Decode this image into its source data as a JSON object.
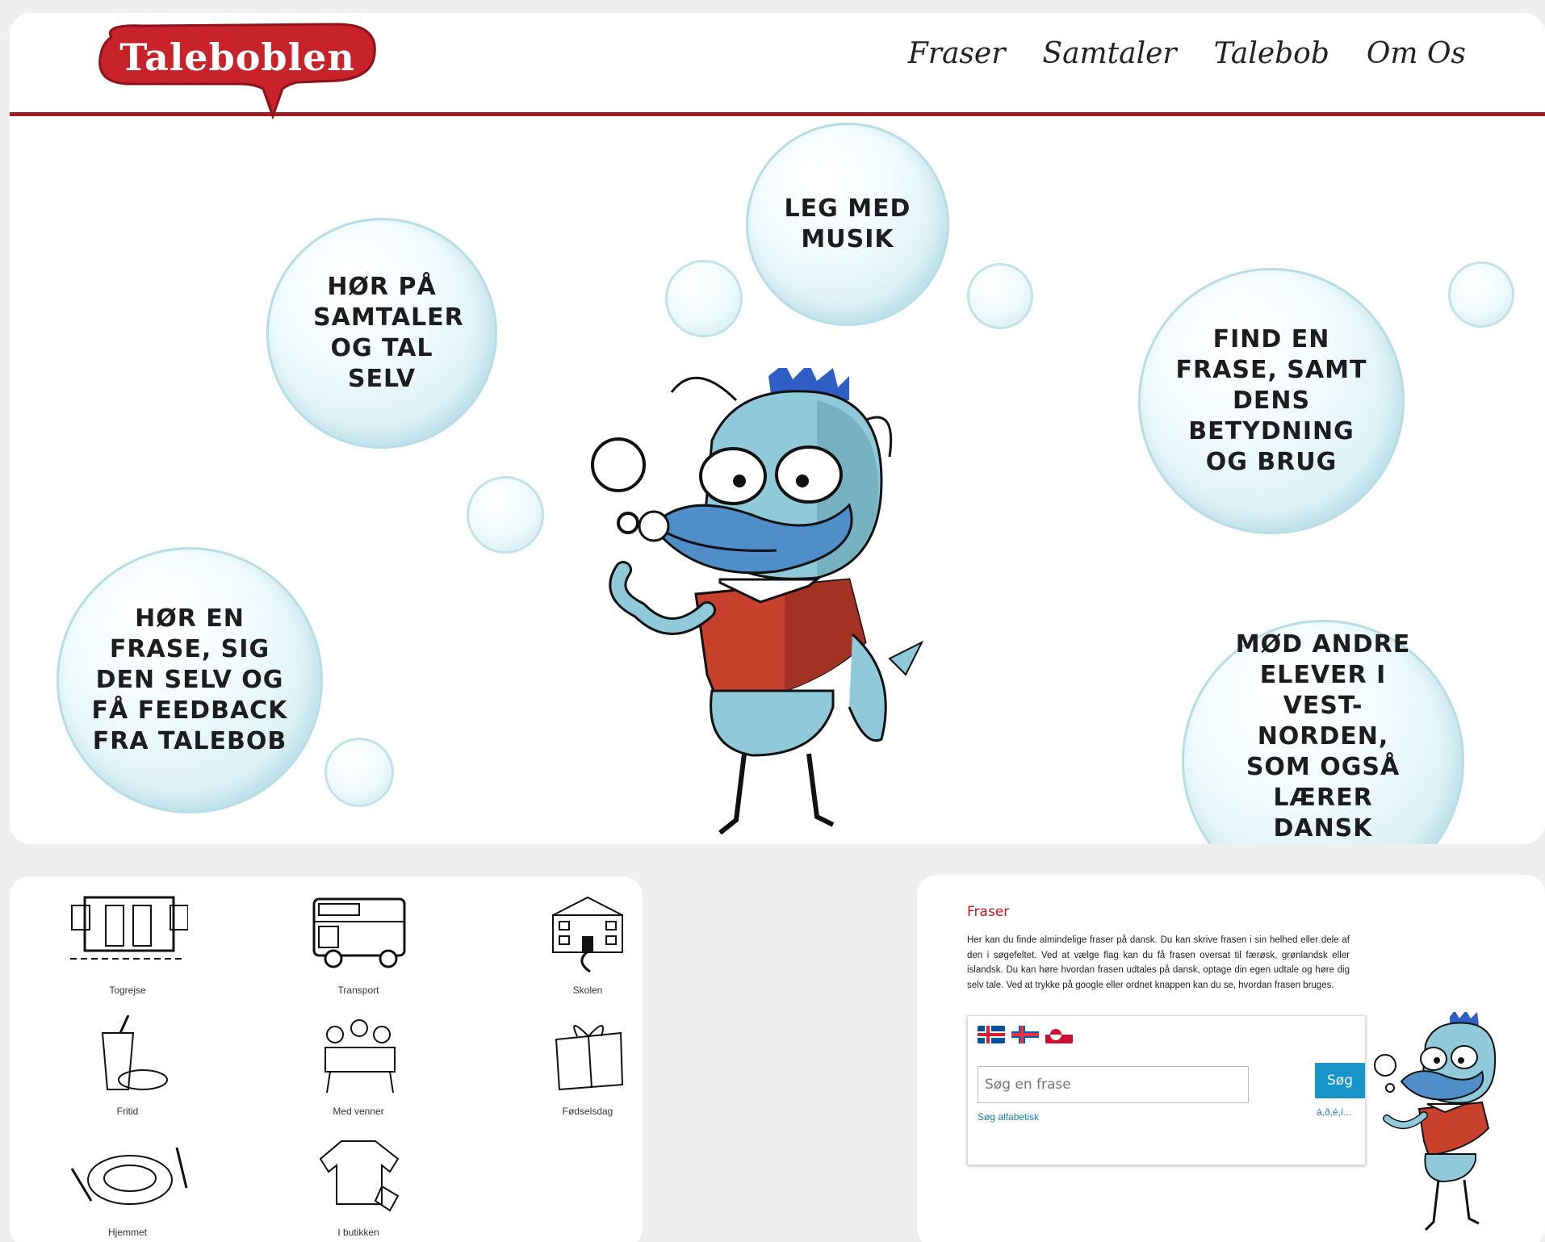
{
  "header": {
    "logo_text": "Taleboblen",
    "nav": [
      "Fraser",
      "Samtaler",
      "Talebob",
      "Om Os"
    ]
  },
  "hero": {
    "bubbles": [
      "LEG MED MUSIK",
      "HØR PÅ SAMTALER OG TAL SELV",
      "FIND EN FRASE, SAMT DENS BETYDNING OG BRUG",
      "HØR EN FRASE, SIG DEN SELV OG FÅ FEEDBACK FRA TALEBOB",
      "MØD ANDRE ELEVER I VEST-NORDEN, SOM OGSÅ LÆRER DANSK"
    ]
  },
  "categories": [
    {
      "label": "Togrejse",
      "icon": "train-icon"
    },
    {
      "label": "Transport",
      "icon": "bus-icon"
    },
    {
      "label": "Skolen",
      "icon": "school-icon"
    },
    {
      "label": "Fritid",
      "icon": "fastfood-icon"
    },
    {
      "label": "Med venner",
      "icon": "friends-icon"
    },
    {
      "label": "Fødselsdag",
      "icon": "gift-icon"
    },
    {
      "label": "Hjemmet",
      "icon": "dinner-plate-icon"
    },
    {
      "label": "I butikken",
      "icon": "sweater-tag-icon"
    }
  ],
  "fraser": {
    "title": "Fraser",
    "description": "Her kan du finde almindelige fraser på dansk. Du kan skrive frasen i sin helhed eller dele af den i søgefeltet. Ved at vælge flag kan du få frasen oversat til færøsk, grønlandsk eller islandsk. Du kan høre hvordan frasen udtales på dansk, optage din egen udtale og høre dig selv tale. Ved at trykke på google eller ordnet knappen kan du se, hvordan frasen bruges.",
    "flags": [
      "iceland-flag",
      "faroe-flag",
      "greenland-flag"
    ],
    "search_placeholder": "Søg en frase",
    "search_button": "Søg",
    "alpha_link": "Søg alfabetisk",
    "chars_link": "á,ð,é,í..."
  }
}
